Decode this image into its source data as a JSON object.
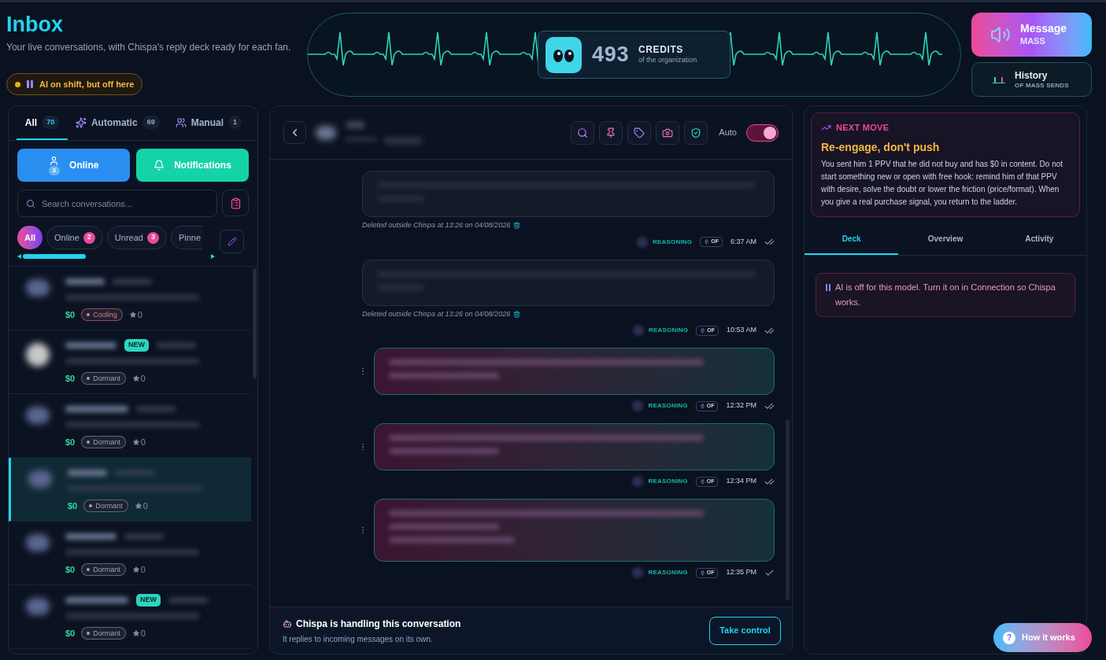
{
  "header": {
    "title": "Inbox",
    "subtitle": "Your live conversations, with Chispa's reply deck ready for each fan.",
    "status_badge": "AI on shift, but off here"
  },
  "credits": {
    "value": "493",
    "label": "CREDITS",
    "sublabel": "of the organization"
  },
  "mass_button": {
    "title": "Message",
    "subtitle": "MASS"
  },
  "history_button": {
    "title": "History",
    "subtitle": "OF MASS SENDS"
  },
  "inbox_tabs": [
    {
      "label": "All",
      "count": "70",
      "selected": true,
      "kind": "all"
    },
    {
      "label": "Automatic",
      "count": "69",
      "selected": false,
      "kind": "automatic"
    },
    {
      "label": "Manual",
      "count": "1",
      "selected": false,
      "kind": "manual"
    }
  ],
  "online_button": {
    "label": "Online",
    "count": "3"
  },
  "notifications_button": {
    "label": "Notifications"
  },
  "search": {
    "placeholder": "Search conversations..."
  },
  "filters": [
    {
      "label": "All",
      "selected": true
    },
    {
      "label": "Online",
      "count": "2",
      "selected": false
    },
    {
      "label": "Unread",
      "count": "3",
      "selected": false
    },
    {
      "label": "Pinne",
      "selected": false
    }
  ],
  "conversations": [
    {
      "amount": "$0",
      "status": "Cooling",
      "color": "#fb7185",
      "rating": "0",
      "selected": false
    },
    {
      "badge": "NEW",
      "amount": "$0",
      "status": "Dormant",
      "color": "#9ca3af",
      "rating": "0",
      "selected": false
    },
    {
      "amount": "$0",
      "status": "Dormant",
      "color": "#9ca3af",
      "rating": "0",
      "selected": false
    },
    {
      "amount": "$0",
      "status": "Dormant",
      "color": "#9ca3af",
      "rating": "0",
      "selected": true
    },
    {
      "amount": "$0",
      "status": "Dormant",
      "color": "#9ca3af",
      "rating": "0",
      "selected": false
    },
    {
      "badge": "NEW",
      "amount": "$0",
      "status": "Dormant",
      "color": "#9ca3af",
      "rating": "0",
      "selected": false
    }
  ],
  "chat": {
    "auto": {
      "label": "Auto",
      "on": true
    },
    "messages": [
      {
        "kind": "incoming",
        "note": "Deleted outside Chispa at 13:26 on 04/08/2026",
        "tag": "REASONING",
        "platform": "OF",
        "time": "6:37 AM",
        "read": true
      },
      {
        "kind": "incoming",
        "note": "Deleted outside Chispa at 13:26 on 04/08/2026",
        "tag": "REASONING",
        "platform": "OF",
        "time": "10:53 AM",
        "read": true
      },
      {
        "kind": "outgoing",
        "tag": "REASONING",
        "platform": "OF",
        "time": "12:32 PM",
        "read": true
      },
      {
        "kind": "outgoing",
        "tag": "REASONING",
        "platform": "OF",
        "time": "12:34 PM",
        "read": true
      },
      {
        "kind": "outgoing",
        "tag": "REASONING",
        "platform": "OF",
        "time": "12:35 PM",
        "read": false
      }
    ],
    "footer": {
      "title": "Chispa is handling this conversation",
      "subtitle": "It replies to incoming messages on its own.",
      "button": "Take control"
    }
  },
  "next_move": {
    "label": "NEXT MOVE",
    "title": "Re-engage, don't push",
    "body": "You sent him 1 PPV that he did not buy and has $0 in content. Do not start something new or open with free hook: remind him of that PPV with desire, solve the doubt or lower the friction (price/format). When you give a real purchase signal, you return to the ladder."
  },
  "side_tabs": [
    {
      "label": "Deck",
      "selected": true
    },
    {
      "label": "Overview",
      "selected": false
    },
    {
      "label": "Activity",
      "selected": false
    }
  ],
  "notice": "AI is off for this model. Turn it on in Connection so Chispa works.",
  "help_button": {
    "icon": "?",
    "label": "How it works"
  }
}
